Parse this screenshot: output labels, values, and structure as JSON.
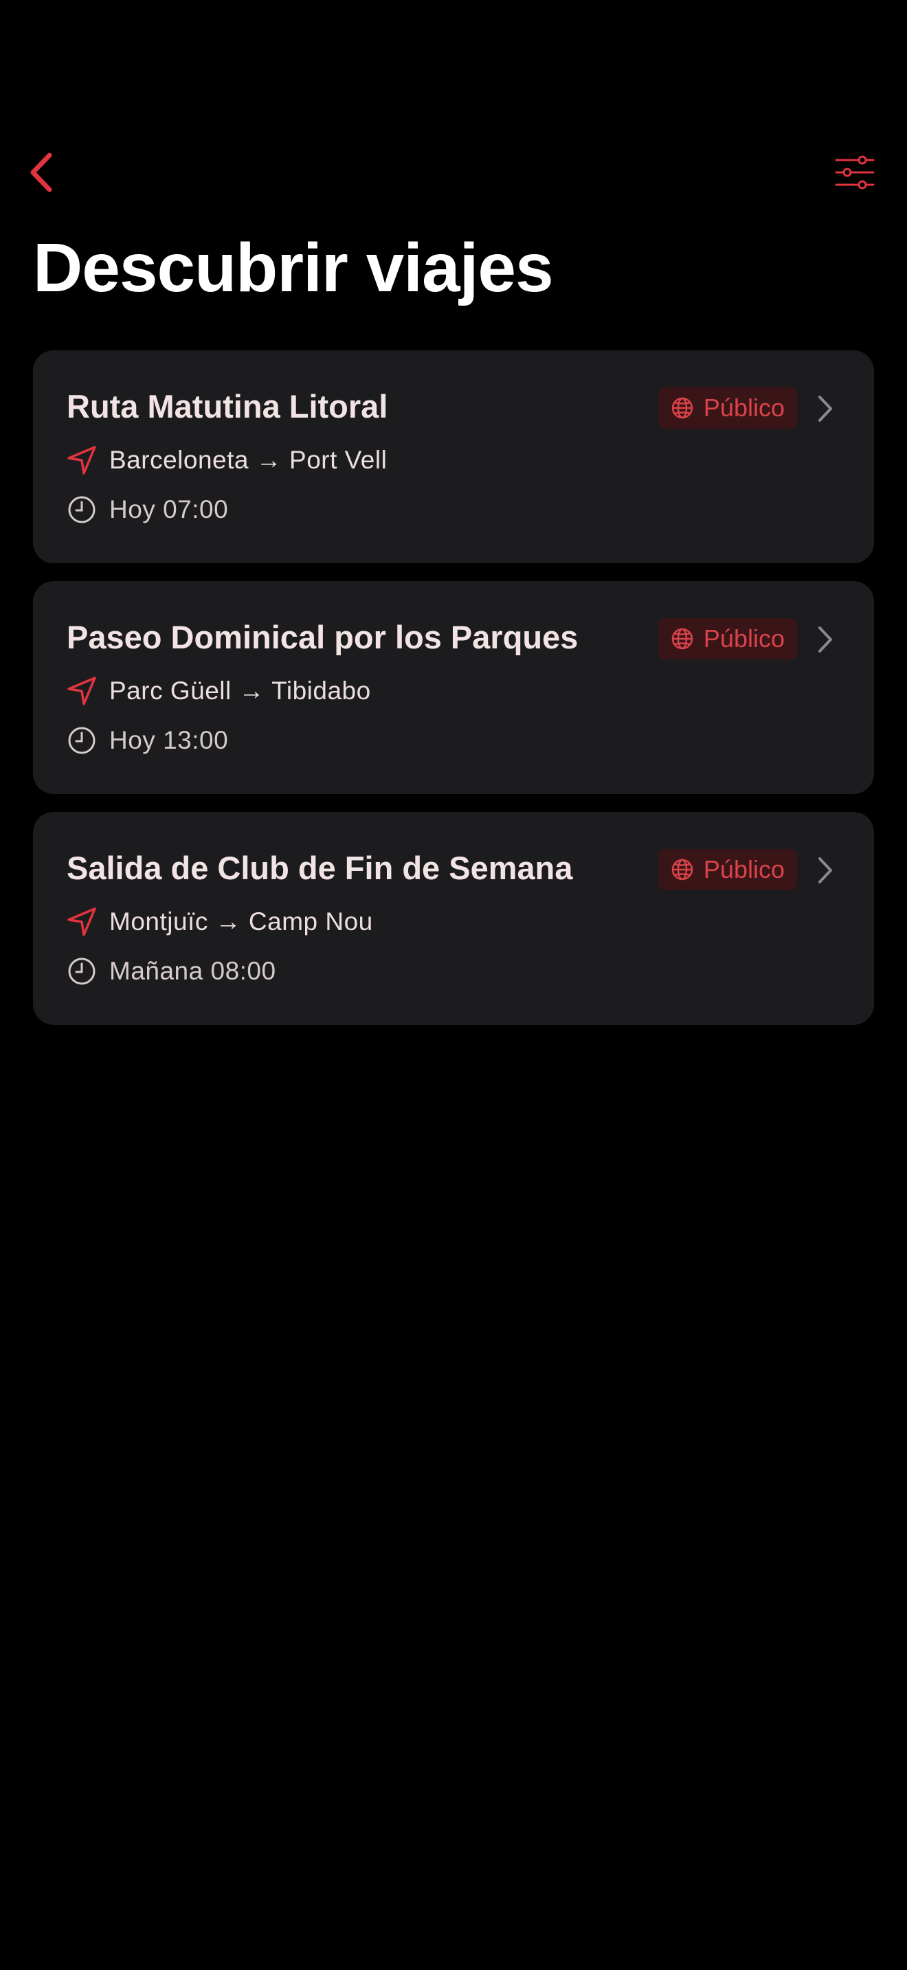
{
  "nav": {
    "back_icon": "chevron-left-icon",
    "filter_icon": "sliders-icon",
    "accent": "#e0343f"
  },
  "title": "Descubrir viajes",
  "trips": [
    {
      "title": "Ruta Matutina Litoral",
      "badge": "Público",
      "route": "Barceloneta → Port Vell",
      "time": "Hoy 07:00"
    },
    {
      "title": "Paseo Dominical por los Parques",
      "badge": "Público",
      "route": "Parc Güell → Tibidabo",
      "time": "Hoy 13:00"
    },
    {
      "title": "Salida de Club de Fin de Semana",
      "badge": "Público",
      "route": "Montjuïc → Camp Nou",
      "time": "Mañana 08:00"
    }
  ]
}
